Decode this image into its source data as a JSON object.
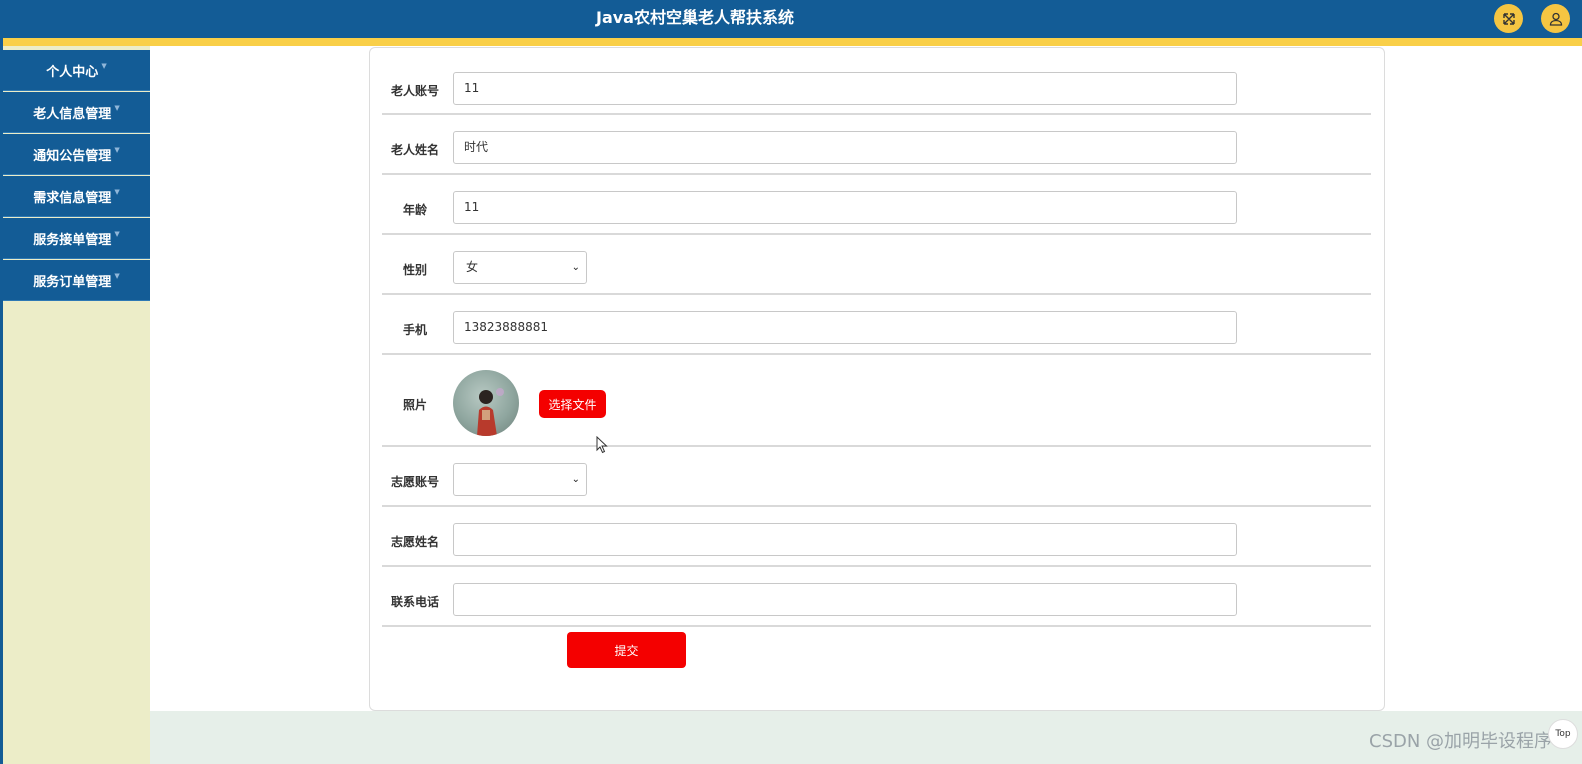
{
  "header": {
    "title": "Java农村空巢老人帮扶系统",
    "fullscreen_icon": "fullscreen-icon",
    "user_icon": "user-icon",
    "bg_color": "#135c96",
    "stripe_color": "#f9cf48"
  },
  "sidebar": {
    "items": [
      {
        "label": "个人中心"
      },
      {
        "label": "老人信息管理"
      },
      {
        "label": "通知公告管理"
      },
      {
        "label": "需求信息管理"
      },
      {
        "label": "服务接单管理"
      },
      {
        "label": "服务订单管理"
      }
    ]
  },
  "form": {
    "account_label": "老人账号",
    "account_value": "11",
    "name_label": "老人姓名",
    "name_value": "时代",
    "age_label": "年龄",
    "age_value": "11",
    "gender_label": "性别",
    "gender_value": "女",
    "phone_label": "手机",
    "phone_value": "13823888881",
    "photo_label": "照片",
    "choose_file_label": "选择文件",
    "volunteer_account_label": "志愿账号",
    "volunteer_account_value": "",
    "volunteer_name_label": "志愿姓名",
    "volunteer_name_value": "",
    "contact_phone_label": "联系电话",
    "contact_phone_value": "",
    "submit_label": "提交",
    "button_color": "#f40000"
  },
  "watermark": "CSDN @加明毕设程序",
  "back_to_top_label": "Top"
}
